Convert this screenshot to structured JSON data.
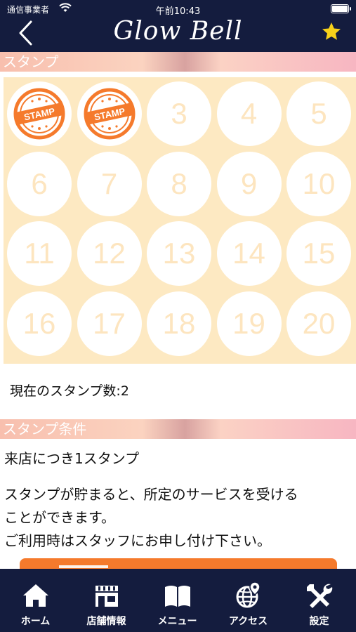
{
  "status_bar": {
    "carrier": "通信事業者",
    "time": "午前10:43"
  },
  "nav": {
    "title": "Glow Bell",
    "back_icon": "chevron-left-icon",
    "favorite_icon": "star-icon"
  },
  "stamp_section": {
    "header": "スタンプ",
    "stamp_text": "STAMP",
    "cells": [
      "",
      "",
      "3",
      "4",
      "5",
      "6",
      "7",
      "8",
      "9",
      "10",
      "11",
      "12",
      "13",
      "14",
      "15",
      "16",
      "17",
      "18",
      "19",
      "20"
    ],
    "stamped_count": 2,
    "current_count_text": "現在のスタンプ数:2"
  },
  "conditions_section": {
    "header": "スタンプ条件",
    "condition": "来店につき1スタンプ",
    "description_lines": [
      "スタンプが貯まると、所定のサービスを受ける",
      "ことができます。",
      "ご利用時はスタッフにお申し付け下さい。"
    ]
  },
  "tabs": [
    {
      "label": "ホーム",
      "icon": "home-icon"
    },
    {
      "label": "店舗情報",
      "icon": "store-icon"
    },
    {
      "label": "メニュー",
      "icon": "book-icon"
    },
    {
      "label": "アクセス",
      "icon": "globe-pin-icon"
    },
    {
      "label": "設定",
      "icon": "tools-icon"
    }
  ],
  "colors": {
    "nav_bg": "#141c3e",
    "card_bg": "#fde9c2",
    "stamp_orange": "#f57a2c",
    "number_color": "#fde5bf"
  }
}
